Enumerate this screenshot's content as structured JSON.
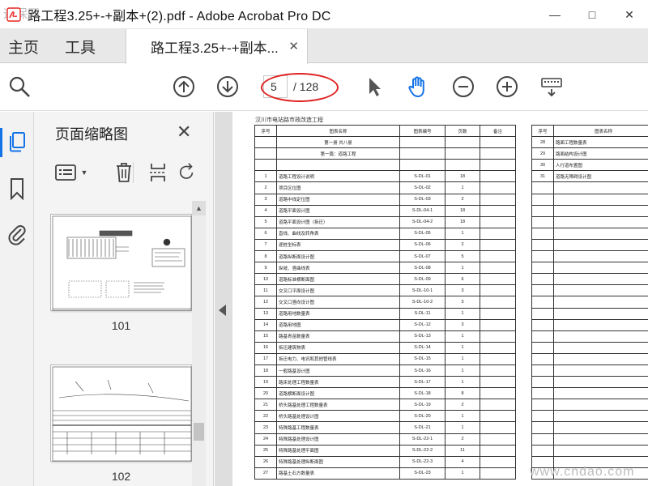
{
  "window": {
    "title": "路工程3.25+-+副本+(2).pdf - Adobe Acrobat Pro DC",
    "watermark_top": "通保网",
    "watermark_bottom": "www.cndao.com"
  },
  "menu": {
    "home": "主页",
    "tools": "工具"
  },
  "tab": {
    "label": "路工程3.25+-+副本...",
    "close": "✕"
  },
  "toolbar": {
    "current_page": "5",
    "total_pages": "/ 128"
  },
  "panel": {
    "title": "页面缩略图",
    "close": "✕",
    "thumbnails": [
      {
        "label": "101"
      },
      {
        "label": "102"
      }
    ]
  },
  "document": {
    "title": "汉川市电站路市政改造工程",
    "headers": {
      "no": "序号",
      "name": "图表名称",
      "code": "图表编号",
      "pages": "页数",
      "remark": "备注"
    },
    "section1": "第一册 共八册",
    "section2": "第一篇：道路工程",
    "rows": [
      {
        "no": "1",
        "name": "道路工程设计说明",
        "code": "S-DL-01",
        "pages": "18"
      },
      {
        "no": "2",
        "name": "项目区位图",
        "code": "S-DL-02",
        "pages": "1"
      },
      {
        "no": "3",
        "name": "道路中线定位图",
        "code": "S-DL-03",
        "pages": "2"
      },
      {
        "no": "4",
        "name": "道路平面设计图",
        "code": "S-DL-04-1",
        "pages": "18"
      },
      {
        "no": "5",
        "name": "道路平面设计图（拆迁）",
        "code": "S-DL-04-2",
        "pages": "18"
      },
      {
        "no": "6",
        "name": "直线、曲线及转角表",
        "code": "S-DL-05",
        "pages": "1"
      },
      {
        "no": "7",
        "name": "逐桩坐标表",
        "code": "S-DL-06",
        "pages": "2"
      },
      {
        "no": "8",
        "name": "道路纵断面设计图",
        "code": "S-DL-07",
        "pages": "5"
      },
      {
        "no": "9",
        "name": "纵坡、竖曲线表",
        "code": "S-DL-08",
        "pages": "1"
      },
      {
        "no": "10",
        "name": "道路标准横断面图",
        "code": "S-DL-09",
        "pages": "6"
      },
      {
        "no": "11",
        "name": "交叉口平面设计图",
        "code": "S-DL-10-1",
        "pages": "3"
      },
      {
        "no": "12",
        "name": "交叉口竖向设计图",
        "code": "S-DL-10-2",
        "pages": "3"
      },
      {
        "no": "13",
        "name": "道路用地数量表",
        "code": "S-DL-11",
        "pages": "1"
      },
      {
        "no": "14",
        "name": "道路用地图",
        "code": "S-DL-12",
        "pages": "3"
      },
      {
        "no": "15",
        "name": "路基青苗数量表",
        "code": "S-DL-13",
        "pages": "1"
      },
      {
        "no": "16",
        "name": "拆迁建筑物表",
        "code": "S-DL-14",
        "pages": "1"
      },
      {
        "no": "17",
        "name": "拆迁电力、电讯和其他管线表",
        "code": "S-DL-15",
        "pages": "1"
      },
      {
        "no": "18",
        "name": "一般路基设计图",
        "code": "S-DL-16",
        "pages": "1"
      },
      {
        "no": "19",
        "name": "路床处理工程数量表",
        "code": "S-DL-17",
        "pages": "1"
      },
      {
        "no": "20",
        "name": "道路横断面设计图",
        "code": "S-DL-18",
        "pages": "8"
      },
      {
        "no": "21",
        "name": "桥头路基处理工程数量表",
        "code": "S-DL-19",
        "pages": "2"
      },
      {
        "no": "22",
        "name": "桥头路基处理设计图",
        "code": "S-DL-20",
        "pages": "1"
      },
      {
        "no": "23",
        "name": "特殊路基工程数量表",
        "code": "S-DL-21",
        "pages": "1"
      },
      {
        "no": "24",
        "name": "特殊路基处理设计图",
        "code": "S-DL-22-1",
        "pages": "2"
      },
      {
        "no": "25",
        "name": "特殊路基处理平面图",
        "code": "S-DL-22-2",
        "pages": "11"
      },
      {
        "no": "26",
        "name": "特殊路基处理纵断面图",
        "code": "S-DL-22-3",
        "pages": "4"
      },
      {
        "no": "27",
        "name": "路基土石方数量表",
        "code": "S-DL-23",
        "pages": "1"
      }
    ],
    "rows_right": [
      {
        "no": "28",
        "name": "路面工程数量表"
      },
      {
        "no": "29",
        "name": "路面结构设计图"
      },
      {
        "no": "30",
        "name": "人行道布置图"
      },
      {
        "no": "31",
        "name": "道路无障碍设计图"
      }
    ]
  },
  "colors": {
    "accent": "#1473e6",
    "highlight_ring": "#e02020",
    "adobe_red": "#e8231f"
  }
}
